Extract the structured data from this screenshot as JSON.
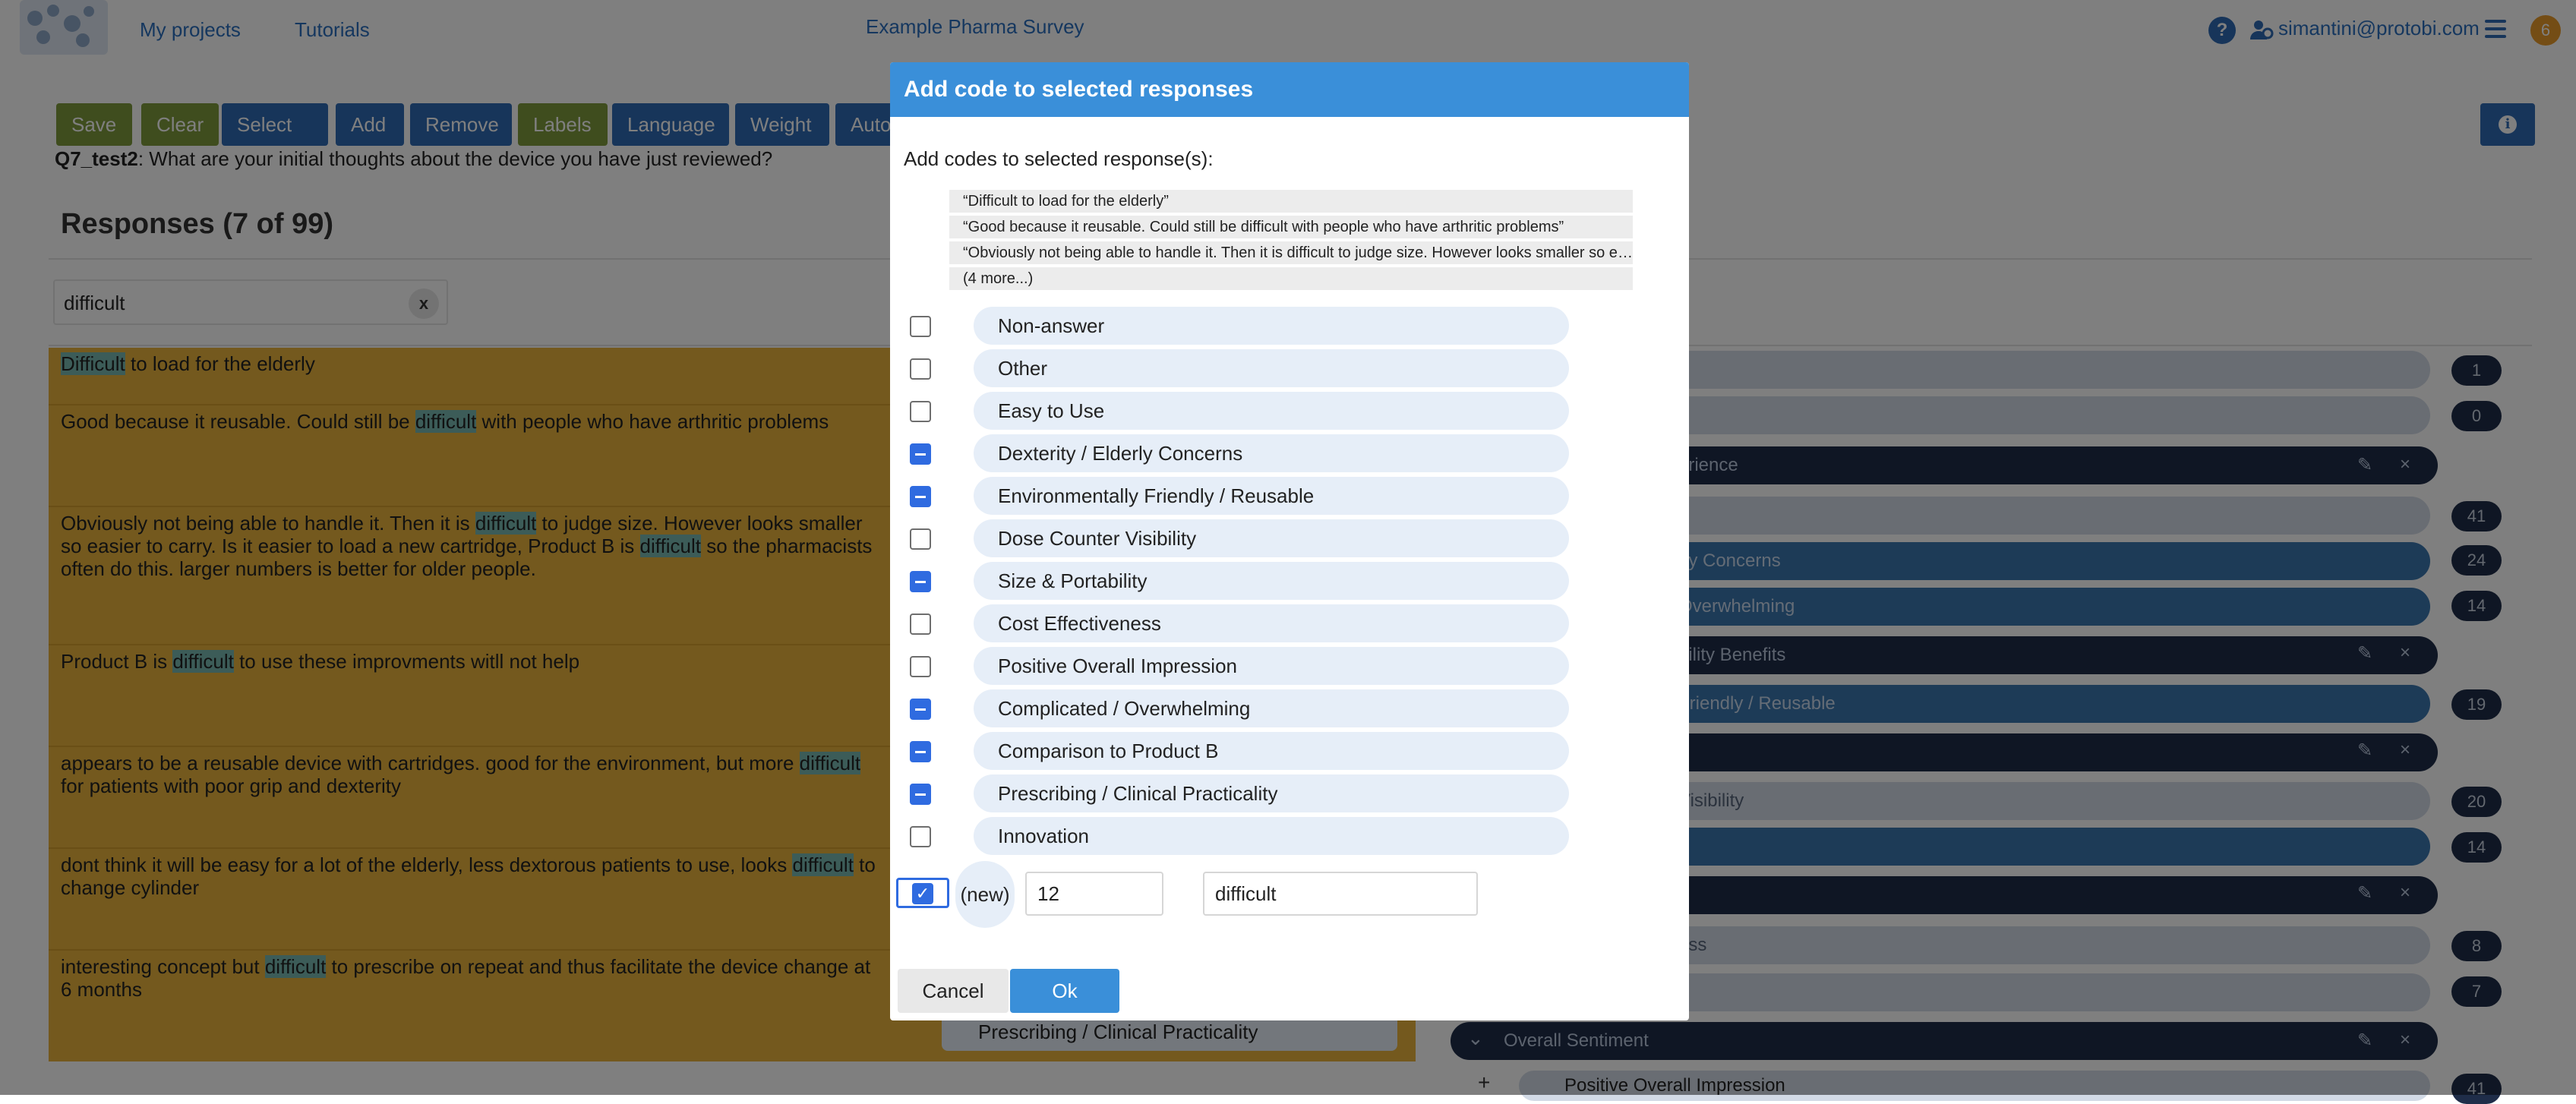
{
  "nav": {
    "my_projects": "My projects",
    "tutorials": "Tutorials",
    "survey_title": "Example Pharma Survey",
    "help": "?",
    "user_email": "simantini@protobi.com",
    "notifications": "6"
  },
  "toolbar": {
    "save": "Save",
    "clear": "Clear",
    "select_all": "Select all",
    "add": "Add",
    "remove": "Remove",
    "labels": "Labels",
    "language": "Language",
    "weight": "Weight",
    "auto": "Auto"
  },
  "question": {
    "id": "Q7_test2",
    "text": ": What are your initial thoughts about the device you have just reviewed?"
  },
  "responses": {
    "heading": "Responses (7 of 99)",
    "search_value": "difficult",
    "clear_label": "x",
    "items": [
      {
        "pre": "",
        "hl": "Difficult",
        "post": " to load for the elderly"
      },
      {
        "pre": "Good because it reusable. Could still be ",
        "hl": "difficult",
        "post": " with people who have arthritic problems"
      },
      {
        "pre": "Obviously not being able to handle it. Then it is ",
        "hl": "difficult",
        "post": " to judge size. However looks smaller so easier to carry. Is it easier to load a new cartridge, Product B is ",
        "hl2": "difficult",
        "post2": " so the pharmacists often do this. larger numbers is better for older people."
      },
      {
        "pre": "Product B is ",
        "hl": "difficult",
        "post": " to use these improvments witll not help"
      },
      {
        "pre": "appears to be a reusable device with cartridges. good for the environment, but more ",
        "hl": "difficult",
        "post": " for patients with poor grip and dexterity"
      },
      {
        "pre": "dont think it will be easy for a lot of the elderly, less dextorous patients to use, looks ",
        "hl": "difficult",
        "post": " to change cylinder"
      },
      {
        "pre": "interesting concept but ",
        "hl": "difficult",
        "post": " to prescribe on repeat and thus facilitate the device change at 6 months"
      }
    ]
  },
  "right_panel": {
    "pill_experience": "erience",
    "pill_elderly": "rly Concerns",
    "pill_overwhelming": "Overwhelming",
    "pill_ability": "bility Benefits",
    "pill_friendly": " Friendly / Reusable",
    "pill_visibility": "Visibility",
    "pill_y": "y",
    "pill_ess": "ess",
    "overall_sentiment": "Overall Sentiment",
    "positive_overall": "Positive Overall Impression",
    "counts": [
      "1",
      "0",
      "41",
      "24",
      "14",
      "19",
      "20",
      "14",
      "8",
      "7",
      "41"
    ],
    "plus": "+"
  },
  "modal": {
    "title": "Add code to selected responses",
    "subtitle": "Add codes to selected response(s):",
    "quotes": [
      "“Difficult to load for the elderly”",
      "“Good because it reusable. Could still be difficult with people who have arthritic problems”",
      "“Obviously not being able to handle it. Then it is difficult to judge size. However looks smaller so easier to carry. Is it easier to load a new cartridge, Product B is difficult so the pharmacists often do this.”"
    ],
    "more": "(4 more...)",
    "codes": [
      {
        "label": "Non-answer",
        "state": "unchecked"
      },
      {
        "label": "Other",
        "state": "unchecked"
      },
      {
        "label": "Easy to Use",
        "state": "unchecked"
      },
      {
        "label": "Dexterity / Elderly Concerns",
        "state": "indeterminate"
      },
      {
        "label": "Environmentally Friendly / Reusable",
        "state": "indeterminate"
      },
      {
        "label": "Dose Counter Visibility",
        "state": "unchecked"
      },
      {
        "label": "Size & Portability",
        "state": "indeterminate"
      },
      {
        "label": "Cost Effectiveness",
        "state": "unchecked"
      },
      {
        "label": "Positive Overall Impression",
        "state": "unchecked"
      },
      {
        "label": "Complicated / Overwhelming",
        "state": "indeterminate"
      },
      {
        "label": "Comparison to Product B",
        "state": "indeterminate"
      },
      {
        "label": "Prescribing / Clinical Practicality",
        "state": "indeterminate"
      },
      {
        "label": "Innovation",
        "state": "unchecked"
      }
    ],
    "new_label": "(new)",
    "new_code_value": "12",
    "new_label_value": "difficult",
    "cancel": "Cancel",
    "ok": "Ok"
  },
  "under_modal_pill": "Prescribing / Clinical Practicality",
  "icons": {
    "check": "✓",
    "pencil": "✎",
    "close": "×",
    "chevron": "⌄",
    "user": "👥"
  }
}
